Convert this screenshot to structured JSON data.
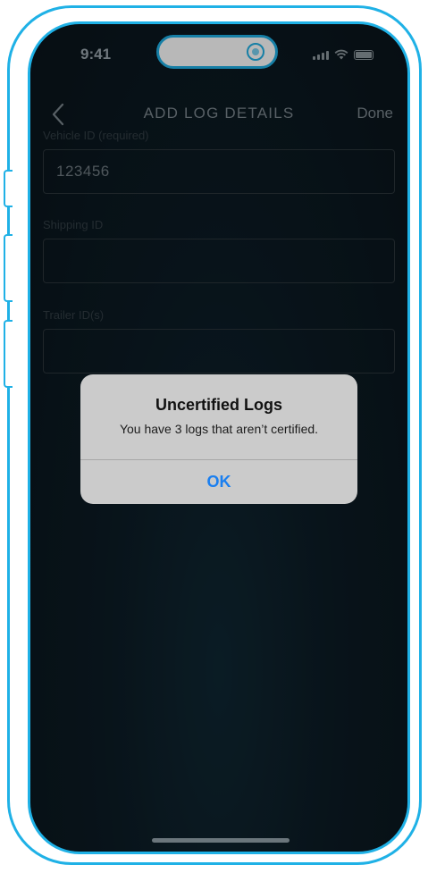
{
  "status_bar": {
    "time": "9:41"
  },
  "nav": {
    "title": "ADD LOG DETAILS",
    "done_label": "Done"
  },
  "form": {
    "vehicle": {
      "label": "Vehicle ID (required)",
      "value": "123456"
    },
    "shipping": {
      "label": "Shipping ID",
      "value": ""
    },
    "trailer": {
      "label": "Trailer ID(s)",
      "value": ""
    }
  },
  "alert": {
    "title": "Uncertified Logs",
    "message": "You have 3 logs that aren’t certified.",
    "ok_label": "OK"
  },
  "colors": {
    "frame": "#1fb1e6",
    "alert_bg": "#cbcbcb",
    "ok": "#1a7ff0"
  }
}
